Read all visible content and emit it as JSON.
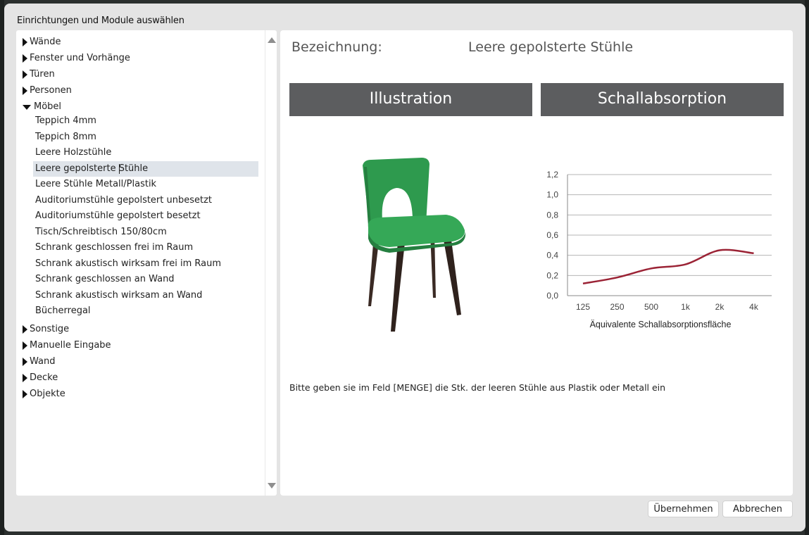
{
  "dialog": {
    "title": "Einrichtungen und Module auswählen"
  },
  "tree": {
    "categories_top": [
      {
        "label": "Wände",
        "expanded": false
      },
      {
        "label": "Fenster und Vorhänge",
        "expanded": false
      },
      {
        "label": "Türen",
        "expanded": false
      },
      {
        "label": "Personen",
        "expanded": false
      },
      {
        "label": "Möbel",
        "expanded": true
      }
    ],
    "moebel_items": [
      "Teppich 4mm",
      "Teppich 8mm",
      "Leere Holzstühle",
      "Leere gepolsterte Stühle",
      "Leere Stühle Metall/Plastik",
      "Auditoriumstühle gepolstert unbesetzt",
      "Auditoriumstühle gepolstert besetzt",
      "Tisch/Schreibtisch 150/80cm",
      "Schrank geschlossen frei im Raum",
      "Schrank akustisch wirksam frei im Raum",
      "Schrank geschlossen an Wand",
      "Schrank akustisch wirksam an Wand",
      "Bücherregal"
    ],
    "selected_item": "Leere gepolsterte Stühle",
    "categories_bottom": [
      {
        "label": "Sonstige"
      },
      {
        "label": "Manuelle Eingabe"
      },
      {
        "label": "Wand"
      },
      {
        "label": "Decke"
      },
      {
        "label": "Objekte"
      }
    ]
  },
  "detail": {
    "bezeichnung_label": "Bezeichnung:",
    "bezeichnung_value": "Leere gepolsterte Stühle",
    "illustration_header": "Illustration",
    "absorption_header": "Schallabsorption",
    "hint": "Bitte geben sie im Feld [MENGE] die Stk. der leeren Stühle aus Plastik oder Metall ein"
  },
  "chart_data": {
    "type": "line",
    "categories": [
      "125",
      "250",
      "500",
      "1k",
      "2k",
      "4k"
    ],
    "series": [
      {
        "values": [
          0.12,
          0.18,
          0.27,
          0.31,
          0.45,
          0.42
        ],
        "color": "#9b2335"
      }
    ],
    "xlabel": "Äquivalente Schallabsorptionsfläche",
    "ylabel": "",
    "ylim": [
      0,
      1.2
    ],
    "y_ticks": [
      "0,0",
      "0,2",
      "0,4",
      "0,6",
      "0,8",
      "1,0",
      "1,2"
    ],
    "grid": true
  },
  "buttons": {
    "apply": "Übernehmen",
    "cancel": "Abbrechen"
  },
  "colors": {
    "header_bg": "#5c5d5f",
    "selection_bg": "#dfe4ea",
    "curve": "#9b2335",
    "chair_green": "#2e9a4e"
  }
}
